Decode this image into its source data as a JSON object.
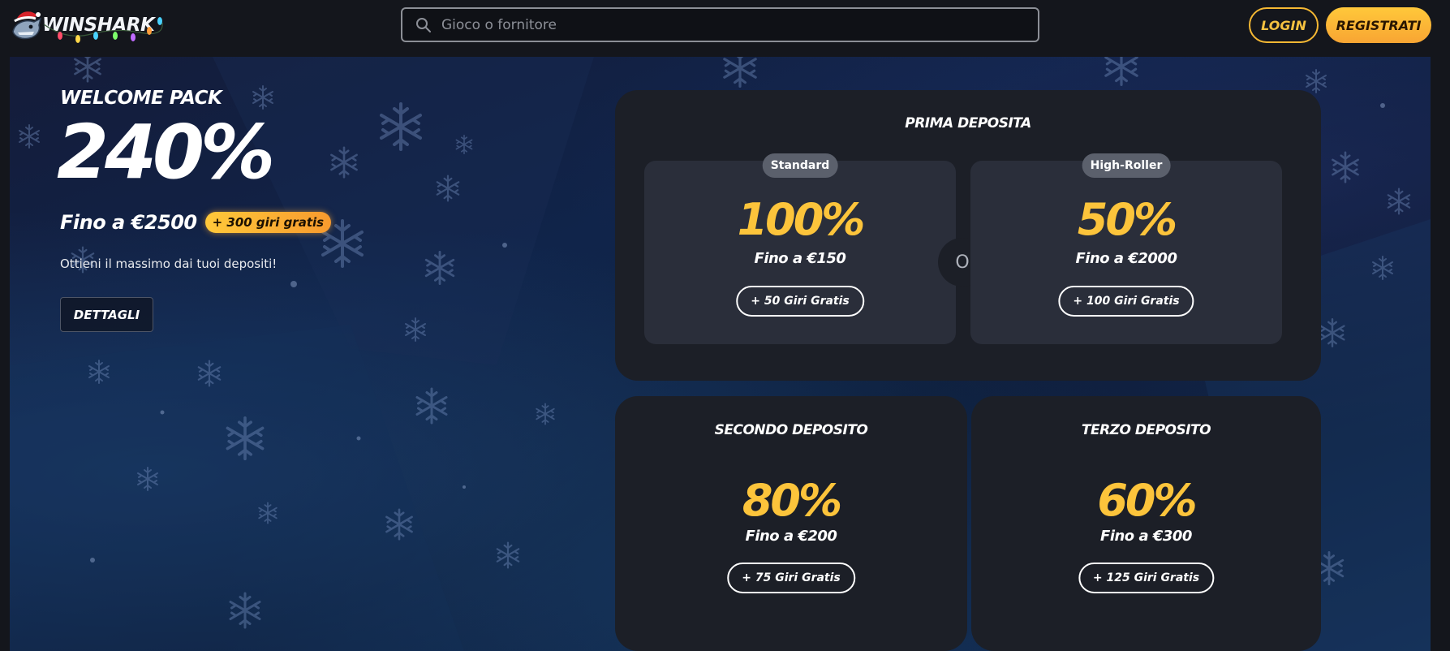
{
  "header": {
    "brand": "WINSHARK",
    "search_placeholder": "Gioco o fornitore",
    "login_label": "LOGIN",
    "register_label": "REGISTRATI"
  },
  "welcome": {
    "title": "WELCOME PACK",
    "percent": "240%",
    "up_to": "Fino a €2500",
    "spins_badge": "+ 300 giri gratis",
    "subtitle": "Ottieni il massimo dai tuoi depositi!",
    "details_label": "DETTAGLI"
  },
  "first_deposit": {
    "title": "PRIMA DEPOSITA",
    "or_label": "O",
    "options": [
      {
        "badge": "Standard",
        "percent": "100%",
        "up_to": "Fino a €150",
        "spins": "+ 50 Giri Gratis"
      },
      {
        "badge": "High-Roller",
        "percent": "50%",
        "up_to": "Fino a €2000",
        "spins": "+ 100 Giri Gratis"
      }
    ]
  },
  "second_deposit": {
    "title": "SECONDO DEPOSITO",
    "percent": "80%",
    "up_to": "Fino a €200",
    "spins": "+ 75 Giri Gratis"
  },
  "third_deposit": {
    "title": "TERZO DEPOSITO",
    "percent": "60%",
    "up_to": "Fino a €300",
    "spins": "+ 125 Giri Gratis"
  },
  "colors": {
    "accent_yellow": "#fcc43b",
    "register_gradient_start": "#ffc83a",
    "register_gradient_end": "#f8a533",
    "panel_bg": "#1c1f27",
    "option_bg": "#2a2e3a",
    "page_bg": "#14161c"
  },
  "icons": {
    "search": "magnifier-icon",
    "logo": "shark-santa-icon",
    "background": "snowflake-icon"
  }
}
